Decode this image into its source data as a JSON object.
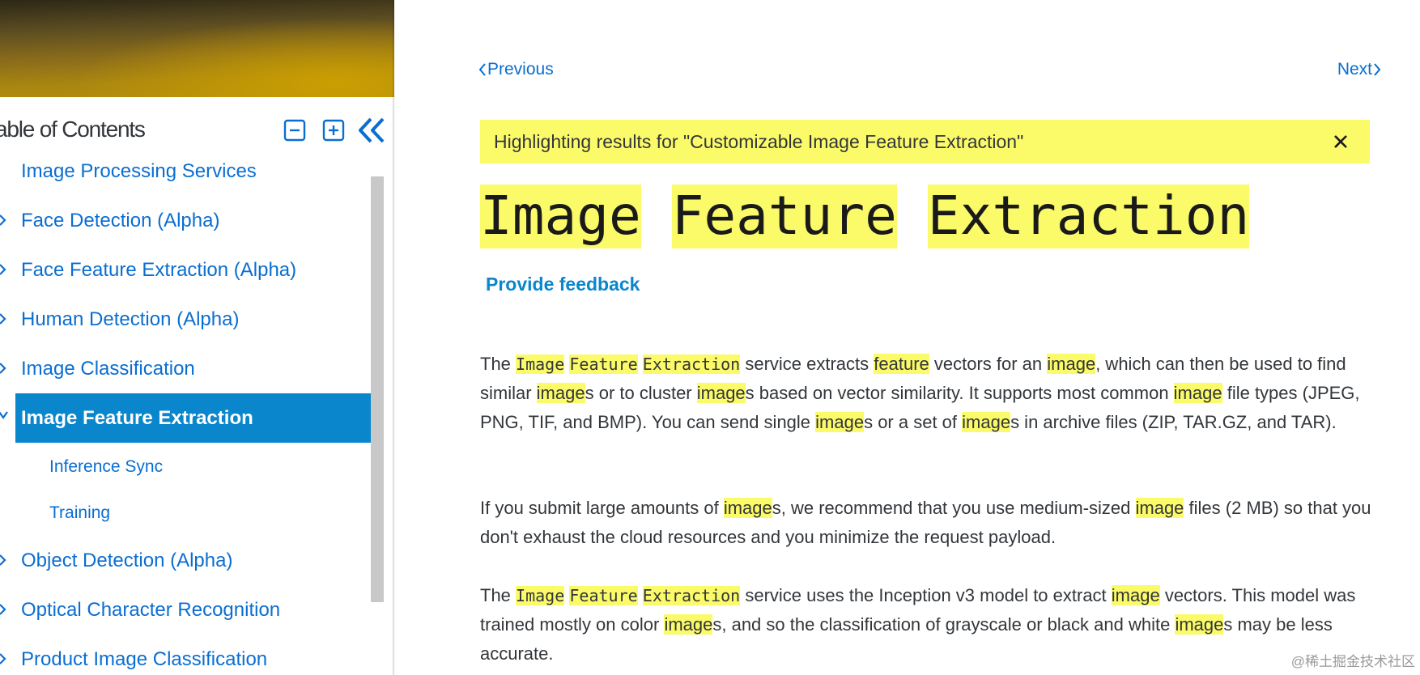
{
  "sidebar": {
    "toc_title": "able of Contents",
    "items": [
      {
        "label": "Image Processing Services"
      },
      {
        "label": "Face Detection (Alpha)"
      },
      {
        "label": "Face Feature Extraction (Alpha)"
      },
      {
        "label": "Human Detection (Alpha)"
      },
      {
        "label": "Image Classification"
      },
      {
        "label": "Image Feature Extraction"
      },
      {
        "label": "Inference Sync"
      },
      {
        "label": "Training"
      },
      {
        "label": "Object Detection (Alpha)"
      },
      {
        "label": "Optical Character Recognition"
      },
      {
        "label": "Product Image Classification"
      }
    ]
  },
  "nav": {
    "previous": "Previous",
    "next": "Next"
  },
  "highlight": {
    "text": "Highlighting results for \"Customizable Image Feature Extraction\""
  },
  "title": {
    "w1": "Image",
    "w2": "Feature",
    "w3": "Extraction"
  },
  "feedback": "Provide feedback",
  "content": {
    "p1": {
      "t1": "Image",
      "t2": "Feature",
      "t3": "Extraction",
      "s1": " service extracts ",
      "h1": "feature",
      "s2": " vectors for an ",
      "h2": "image",
      "s3": ", which can then be used to find similar ",
      "h3": "image",
      "s4": "s or to cluster ",
      "h4": "image",
      "s5": "s based on vector similarity. It supports most common ",
      "h5": "image",
      "s6": " file types (JPEG, PNG, TIF, and BMP). You can send single ",
      "h6": "image",
      "s7": "s or a set of ",
      "h7": "image",
      "s8": "s in archive files (ZIP, TAR.GZ, and TAR)."
    },
    "p2": {
      "s1": "If you submit large amounts of ",
      "h1": "image",
      "s2": "s, we recommend that you use medium-sized ",
      "h2": "image",
      "s3": " files (2 MB) so that you don't exhaust the cloud resources and you minimize the request payload."
    },
    "p3": {
      "t1": "Image",
      "t2": "Feature",
      "t3": "Extraction",
      "s1": " service uses the Inception v3 model to extract ",
      "h1": "image",
      "s2": " vectors. This model was trained mostly on color ",
      "h2": "image",
      "s3": "s, and so the classification of grayscale or black and white ",
      "h3": "image",
      "s4": "s may be less accurate."
    }
  },
  "watermark": "@稀土掘金技术社区",
  "colors": {
    "link": "#0a6ed1",
    "active_bg": "#0a86cd",
    "highlight": "#fbfa68"
  }
}
